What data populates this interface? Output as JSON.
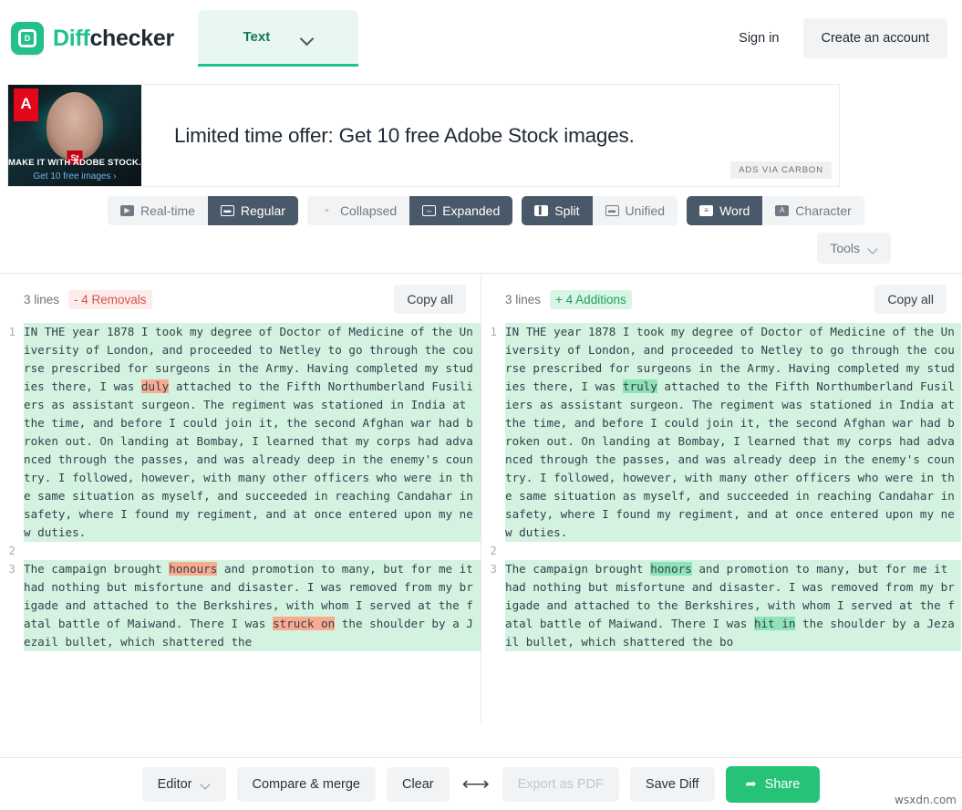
{
  "header": {
    "brand_first": "Diff",
    "brand_second": "checker",
    "logo_letter": "D",
    "type_select_label": "Text",
    "sign_in": "Sign in",
    "create_account": "Create an account"
  },
  "ad": {
    "headline": "Limited time offer: Get 10 free Adobe Stock images.",
    "badge": "ADS VIA CARBON",
    "image_caption_1": "MAKE IT WITH ADOBE STOCK.",
    "image_caption_2": "Get 10 free images ›",
    "adobe_letter": "A",
    "st_badge": "St"
  },
  "toolbar": {
    "groups": [
      {
        "name": "update-mode",
        "buttons": [
          {
            "label": "Real-time",
            "icon": "play-icon",
            "active": false
          },
          {
            "label": "Regular",
            "icon": "window-icon",
            "active": true
          }
        ]
      },
      {
        "name": "view-density",
        "buttons": [
          {
            "label": "Collapsed",
            "icon": "collapse-icon",
            "active": false
          },
          {
            "label": "Expanded",
            "icon": "expand-icon",
            "active": true
          }
        ]
      },
      {
        "name": "layout-mode",
        "buttons": [
          {
            "label": "Split",
            "icon": "split-icon",
            "active": true
          },
          {
            "label": "Unified",
            "icon": "unified-icon",
            "active": false
          }
        ]
      },
      {
        "name": "granularity",
        "buttons": [
          {
            "label": "Word",
            "icon": "word-icon",
            "active": true
          },
          {
            "label": "Character",
            "icon": "character-icon",
            "active": false
          }
        ]
      }
    ],
    "tools_label": "Tools"
  },
  "left_pane": {
    "lines_label": "3 lines",
    "change_badge": "- 4 Removals",
    "copy_all": "Copy all",
    "rows": [
      {
        "number": "1",
        "type": "removal",
        "segments": [
          {
            "text": "IN THE year 1878 I took my degree of Doctor of Medicine of the University of London, and proceeded to Netley to go through the course prescribed for surgeons in the Army. Having completed my studies there, I was ",
            "highlight": false
          },
          {
            "text": "duly",
            "highlight": true
          },
          {
            "text": " attached to the Fifth Northumberland Fusiliers as assistant surgeon. The regiment was stationed in India at the time, and before I could join it, the second Afghan war had broken out. On landing at Bombay, I learned that my corps had advanced through the passes, and was already deep in the enemy's country. I followed, however, with many other officers who were in the same situation as myself, and succeeded in reaching Candahar in safety, where I found my regiment, and at once entered upon my new duties.",
            "highlight": false
          }
        ]
      },
      {
        "number": "2",
        "type": "blank",
        "segments": [
          {
            "text": "",
            "highlight": false
          }
        ]
      },
      {
        "number": "3",
        "type": "removal",
        "segments": [
          {
            "text": "The campaign brought ",
            "highlight": false
          },
          {
            "text": "honours",
            "highlight": true
          },
          {
            "text": " and promotion to many, but for me it had nothing but misfortune and disaster. I was removed from my brigade and attached to the Berkshires, with whom I served at the fatal battle of Maiwand. There I was ",
            "highlight": false
          },
          {
            "text": "struck on",
            "highlight": true
          },
          {
            "text": " the shoulder by a Jezail bullet, which shattered the",
            "highlight": false
          }
        ]
      }
    ]
  },
  "right_pane": {
    "lines_label": "3 lines",
    "change_badge": "+ 4 Additions",
    "copy_all": "Copy all",
    "rows": [
      {
        "number": "1",
        "type": "addition",
        "segments": [
          {
            "text": "IN THE year 1878 I took my degree of Doctor of Medicine of the University of London, and proceeded to Netley to go through the course prescribed for surgeons in the Army. Having completed my studies there, I was ",
            "highlight": false
          },
          {
            "text": "truly",
            "highlight": true
          },
          {
            "text": " attached to the Fifth Northumberland Fusiliers as assistant surgeon. The regiment was stationed in India at the time, and before I could join it, the second Afghan war had broken out. On landing at Bombay, I learned that my corps had advanced through the passes, and was already deep in the enemy's country. I followed, however, with many other officers who were in the same situation as myself, and succeeded in reaching Candahar in safety, where I found my regiment, and at once entered upon my new duties.",
            "highlight": false
          }
        ]
      },
      {
        "number": "2",
        "type": "blank",
        "segments": [
          {
            "text": "",
            "highlight": false
          }
        ]
      },
      {
        "number": "3",
        "type": "addition",
        "segments": [
          {
            "text": "The campaign brought ",
            "highlight": false
          },
          {
            "text": "honors",
            "highlight": true
          },
          {
            "text": " and promotion to many, but for me it had nothing but misfortune and disaster. I was removed from my brigade and attached to the Berkshires, with whom I served at the fatal battle of Maiwand. There I was ",
            "highlight": false
          },
          {
            "text": "hit in",
            "highlight": true
          },
          {
            "text": " the shoulder by a Jezail bullet, which shattered the bo",
            "highlight": false
          }
        ]
      }
    ]
  },
  "bottom_bar": {
    "editor": "Editor",
    "compare_merge": "Compare & merge",
    "clear": "Clear",
    "swap_icon": "⟷",
    "export_pdf": "Export as PDF",
    "save_diff": "Save Diff",
    "share": "Share",
    "share_icon": "➦"
  },
  "watermark": "wsxdn.com",
  "colors": {
    "brand_green": "#22c08a",
    "share_green": "#25c277",
    "removal_bg": "#fbd6c9",
    "removal_mark": "#f9ab90",
    "addition_bg": "#d3f2e0",
    "addition_mark": "#8fe3b8",
    "active_segment": "#4a5969"
  }
}
